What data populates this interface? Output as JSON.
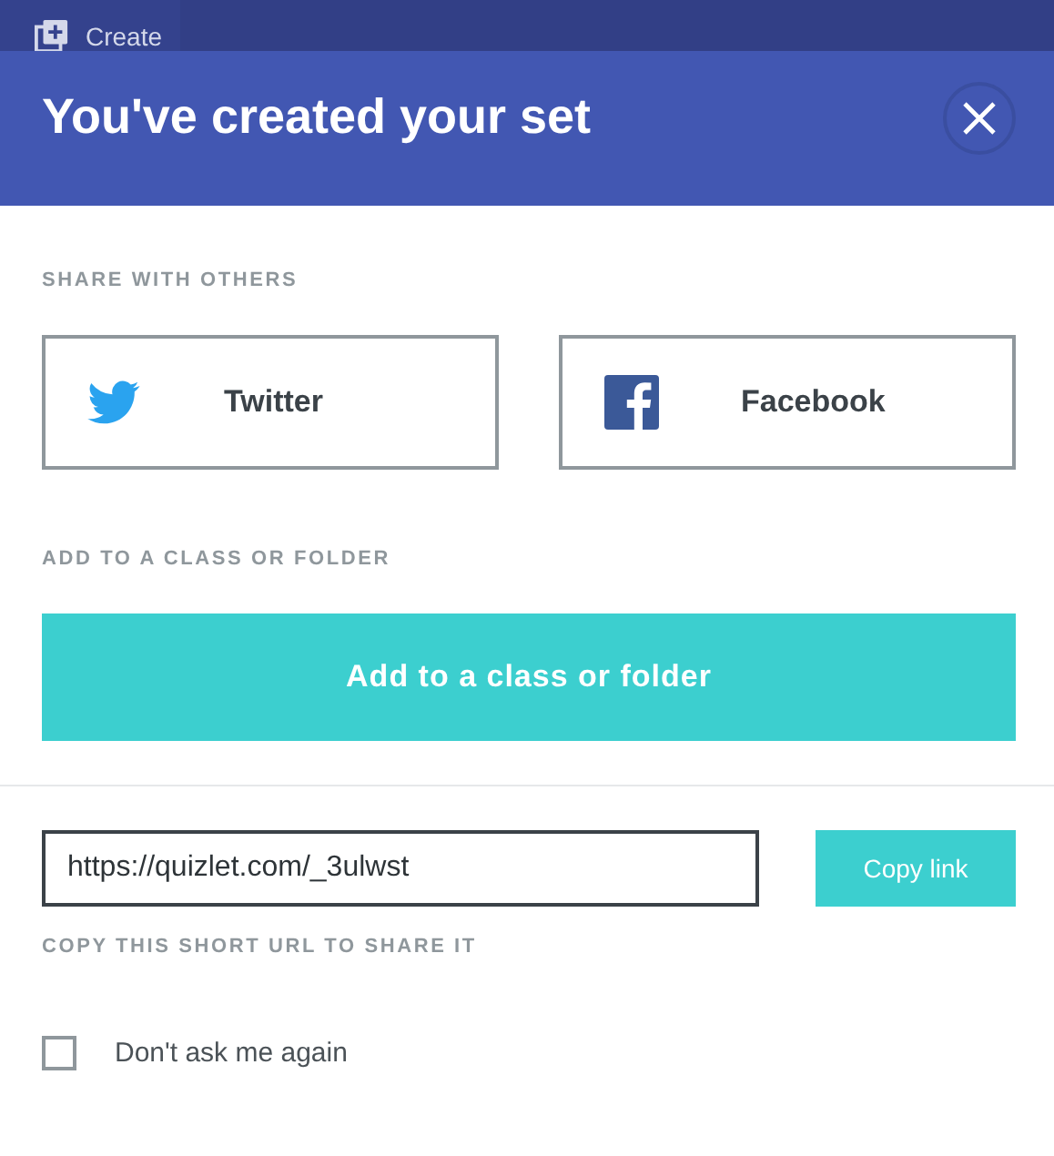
{
  "topbar": {
    "tab": "Create"
  },
  "header": {
    "title": "You've created your set"
  },
  "share": {
    "label": "SHARE WITH OTHERS",
    "buttons": [
      {
        "kind": "twitter",
        "label": "Twitter"
      },
      {
        "kind": "facebook",
        "label": "Facebook"
      }
    ]
  },
  "folder": {
    "label": "ADD TO A CLASS OR FOLDER",
    "button": "Add to a class or folder"
  },
  "link": {
    "value": "https://quizlet.com/_3ulwst",
    "button": "Copy link",
    "hint": "COPY THIS SHORT URL TO SHARE IT"
  },
  "dont_ask": {
    "label": "Don't ask me again",
    "checked": false
  }
}
